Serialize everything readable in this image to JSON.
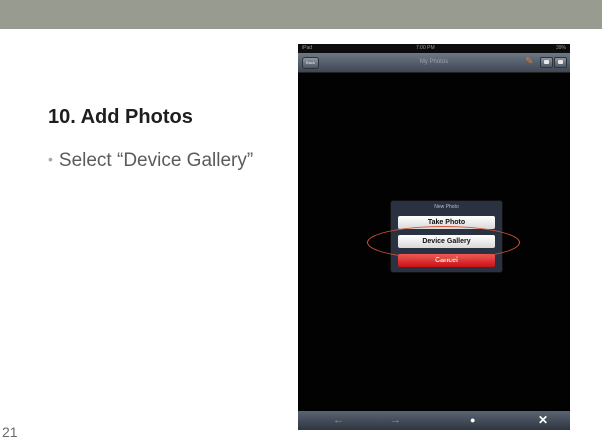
{
  "slide": {
    "title": "10. Add Photos",
    "bullet_glyph": "•",
    "bullet": "Select “Device Gallery”",
    "number": "21",
    "header_color": "#989b8f"
  },
  "device": {
    "status": {
      "carrier": "iPad",
      "time": "7:00 PM",
      "battery": "39%"
    },
    "nav": {
      "back_label": "Back",
      "title": "My Photos",
      "pen_icon": "pencil-icon",
      "mail_icon": "mail-icon",
      "camera_icon": "camera-icon"
    },
    "action_sheet": {
      "title": "New Photo",
      "take_photo": "Take Photo",
      "device_gallery": "Device Gallery",
      "cancel": "Cancel"
    },
    "toolbar": {
      "left_glyph": "←",
      "mid_glyph": "→",
      "dot_glyph": "●",
      "close_glyph": "✕"
    }
  },
  "colors": {
    "highlight": "#d4553b",
    "cancel_button": "#c90f12"
  }
}
